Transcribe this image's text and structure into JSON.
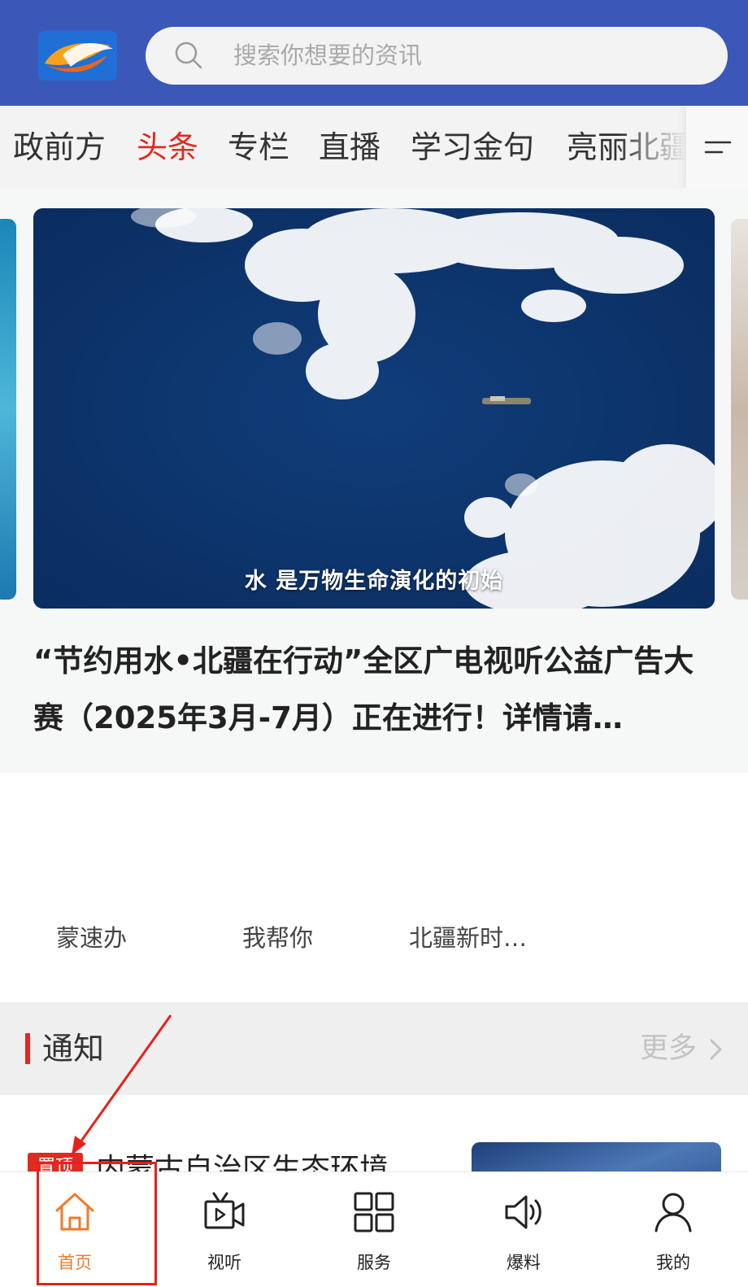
{
  "header": {
    "logo_icon": "app-logo",
    "search": {
      "placeholder": "搜索你想要的资讯",
      "icon": "search-icon"
    }
  },
  "tabs": {
    "items": [
      {
        "label": "政前方",
        "active": false
      },
      {
        "label": "头条",
        "active": true
      },
      {
        "label": "专栏",
        "active": false
      },
      {
        "label": "直播",
        "active": false
      },
      {
        "label": "学习金句",
        "active": false
      },
      {
        "label": "亮丽北疆",
        "active": false
      }
    ],
    "menu_icon": "menu-icon",
    "active_color": "#e02a22"
  },
  "banner": {
    "caption": "水  是万物生命演化的初始",
    "headline": "“节约用水•北疆在行动”全区广电视听公益广告大赛（2025年3月-7月）正在进行！详情请…"
  },
  "quick_links": [
    {
      "label": "蒙速办"
    },
    {
      "label": "我帮你"
    },
    {
      "label": "北疆新时…"
    }
  ],
  "notice": {
    "title": "通知",
    "more": "更多",
    "item": {
      "badge": "置顶",
      "title": "内蒙古自治区生态环境"
    }
  },
  "bottom_nav": [
    {
      "label": "首页",
      "icon": "home-icon",
      "active": true
    },
    {
      "label": "视听",
      "icon": "video-icon",
      "active": false
    },
    {
      "label": "服务",
      "icon": "grid-icon",
      "active": false
    },
    {
      "label": "爆料",
      "icon": "speaker-icon",
      "active": false
    },
    {
      "label": "我的",
      "icon": "user-icon",
      "active": false
    }
  ],
  "colors": {
    "header_bg": "#3b57b8",
    "accent_red": "#e02a22",
    "nav_active": "#f07a2a"
  }
}
